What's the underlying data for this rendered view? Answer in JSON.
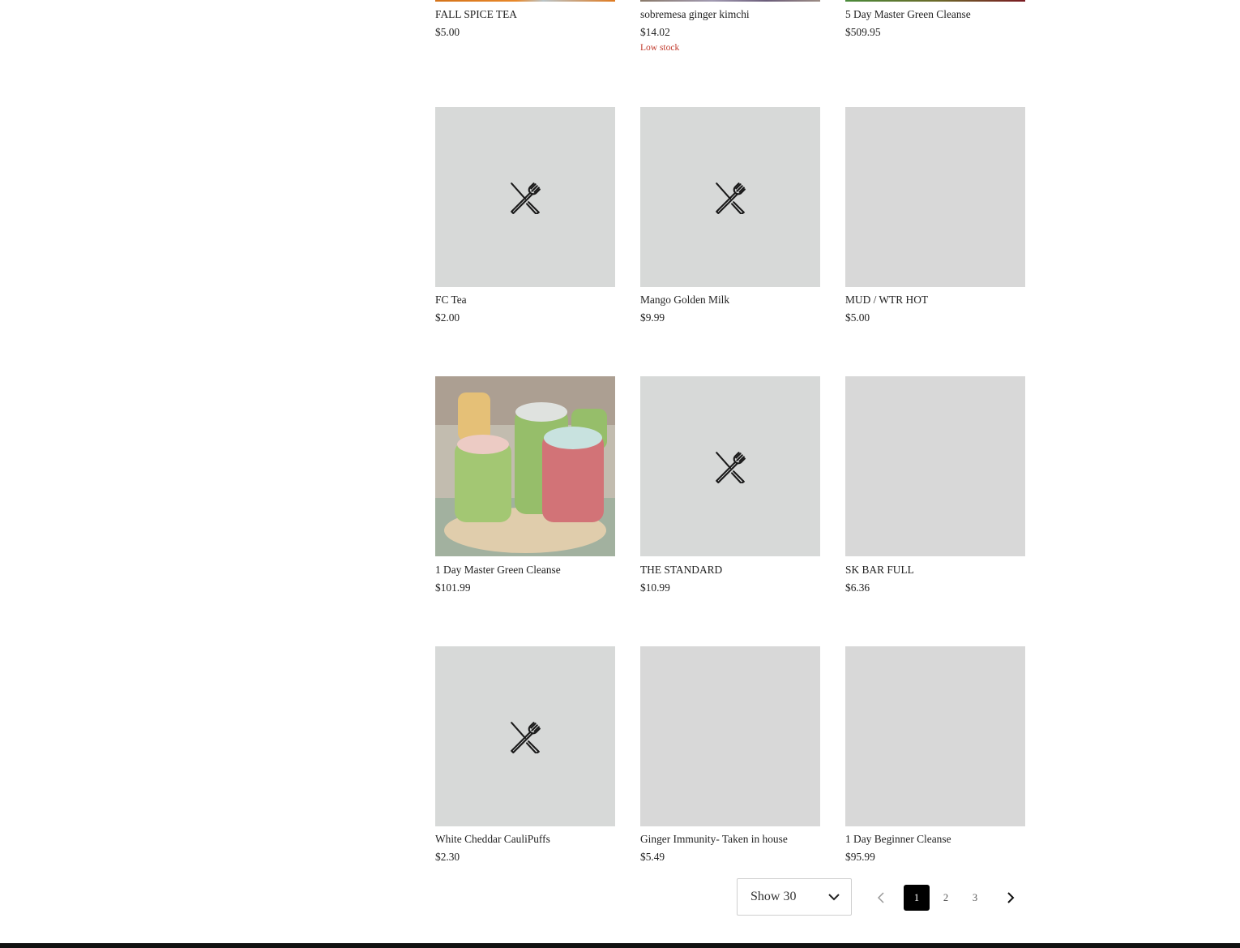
{
  "products": [
    {
      "name": "FALL SPICE TEA",
      "price": "$5.00",
      "stock": "",
      "image": "photo-cropped",
      "accent": "#e07a1f"
    },
    {
      "name": "sobremesa ginger kimchi",
      "price": "$14.02",
      "stock": "Low stock",
      "image": "photo-cropped",
      "accent": "#7a6a8a"
    },
    {
      "name": "5 Day Master Green Cleanse",
      "price": "$509.95",
      "stock": "",
      "image": "photo-cropped",
      "accent": "#6a1a22"
    },
    {
      "name": "FC Tea",
      "price": "$2.00",
      "stock": "",
      "image": "utensils-placeholder"
    },
    {
      "name": "Mango Golden Milk",
      "price": "$9.99",
      "stock": "",
      "image": "utensils-placeholder"
    },
    {
      "name": "MUD / WTR HOT",
      "price": "$5.00",
      "stock": "",
      "image": "blank"
    },
    {
      "name": "1 Day Master Green Cleanse",
      "price": "$101.99",
      "stock": "",
      "image": "juice-jars-photo"
    },
    {
      "name": "THE STANDARD",
      "price": "$10.99",
      "stock": "",
      "image": "utensils-placeholder"
    },
    {
      "name": "SK BAR FULL",
      "price": "$6.36",
      "stock": "",
      "image": "blank"
    },
    {
      "name": "White Cheddar CauliPuffs",
      "price": "$2.30",
      "stock": "",
      "image": "utensils-placeholder"
    },
    {
      "name": "Ginger Immunity- Taken in house",
      "price": "$5.49",
      "stock": "",
      "image": "blank"
    },
    {
      "name": "1 Day Beginner Cleanse",
      "price": "$95.99",
      "stock": "",
      "image": "blank"
    }
  ],
  "pagination": {
    "page_size_label": "Show 30",
    "pages": [
      "1",
      "2",
      "3"
    ],
    "current_page": "1",
    "prev_icon": "chevron-left-icon",
    "next_icon": "chevron-right-icon"
  },
  "colors": {
    "low_stock": "#c0392b",
    "placeholder_bg": "#d7d9d8",
    "active_page_bg": "#000000"
  }
}
